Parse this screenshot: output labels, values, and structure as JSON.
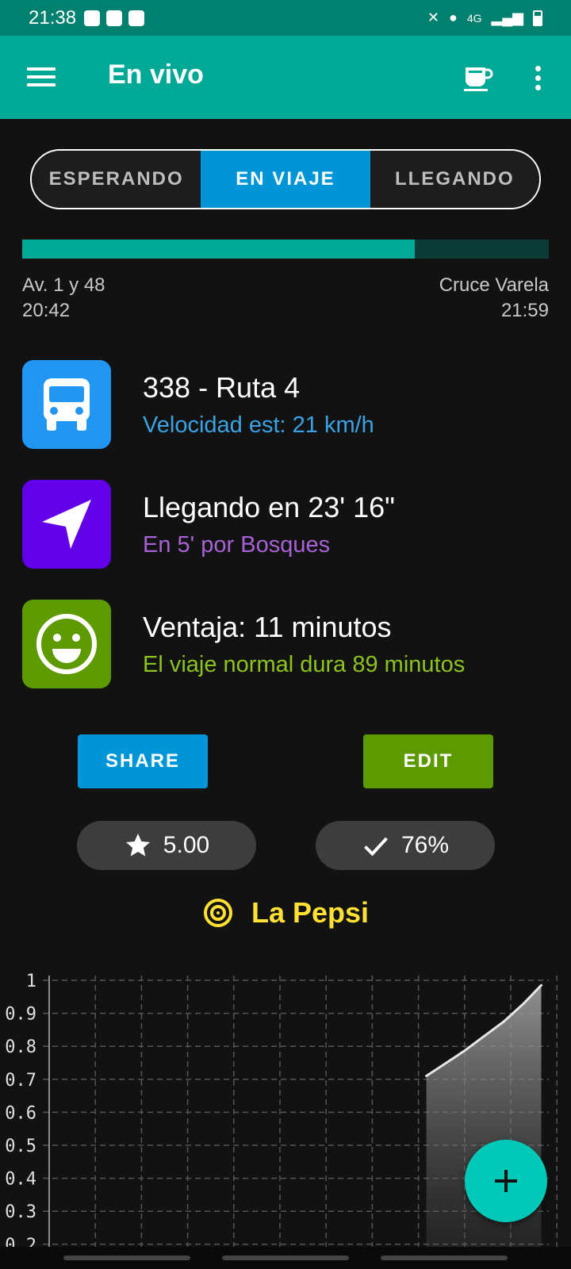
{
  "status_bar": {
    "time": "21:38",
    "network": "4G"
  },
  "app_bar": {
    "title": "En vivo"
  },
  "tabs": [
    {
      "label": "ESPERANDO",
      "active": false
    },
    {
      "label": "EN VIAJE",
      "active": true
    },
    {
      "label": "LLEGANDO",
      "active": false
    }
  ],
  "trip": {
    "progress": 0.745,
    "origin": {
      "name": "Av. 1 y 48",
      "time": "20:42"
    },
    "destination": {
      "name": "Cruce Varela",
      "time": "21:59"
    }
  },
  "info": [
    {
      "icon": "bus-icon",
      "title": "338 - Ruta 4",
      "subtitle": "Velocidad est: 21 km/h",
      "icon_bg": "#2196f3",
      "subtitle_color": "#3aa3e6"
    },
    {
      "icon": "navigation-arrow-icon",
      "title": "Llegando en 23' 16\"",
      "subtitle": "En 5' por Bosques",
      "icon_bg": "#6200ea",
      "subtitle_color": "#a762d6"
    },
    {
      "icon": "smiley-icon",
      "title": "Ventaja: 11 minutos",
      "subtitle": "El viaje normal dura 89 minutos",
      "icon_bg": "#5c9a00",
      "subtitle_color": "#8cc31e"
    }
  ],
  "actions": {
    "share_label": "SHARE",
    "edit_label": "EDIT",
    "share_color": "#0095d6",
    "edit_color": "#5c9a00"
  },
  "stats": {
    "rating": "5.00",
    "accuracy": "76%"
  },
  "place": {
    "name": "La Pepsi",
    "color": "#ffe033"
  },
  "chart_data": {
    "type": "area",
    "y_ticks": [
      "1",
      "0.9",
      "0.8",
      "0.7",
      "0.6",
      "0.5",
      "0.4",
      "0.3",
      "0.2"
    ],
    "ylim": [
      0.2,
      1
    ],
    "grid": true,
    "x": [
      0.755,
      0.79,
      0.83,
      0.87,
      0.91,
      0.95,
      0.985
    ],
    "values": [
      0.71,
      0.745,
      0.785,
      0.83,
      0.875,
      0.93,
      0.985
    ]
  }
}
